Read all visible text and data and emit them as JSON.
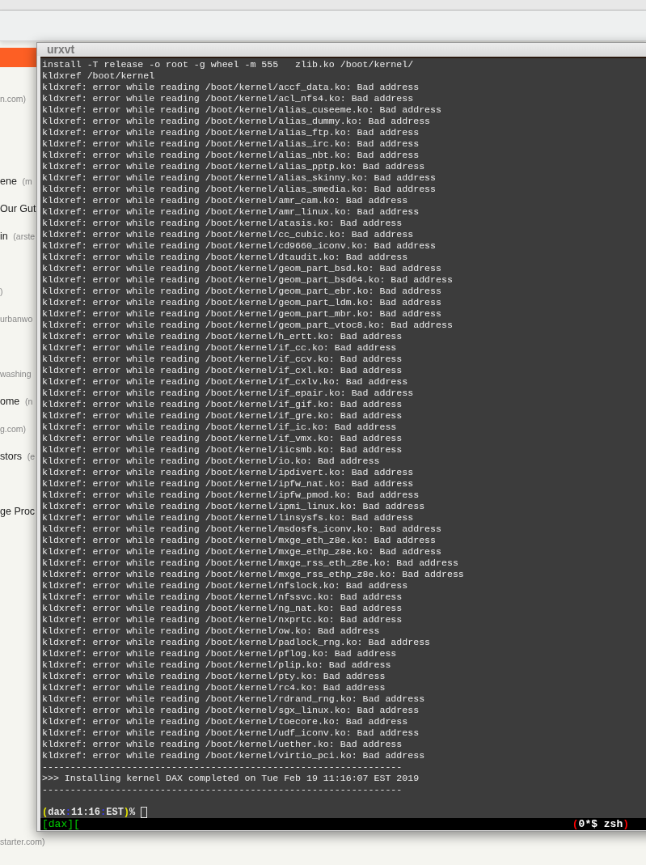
{
  "background_page": {
    "items": [
      {
        "source": "n.com)"
      },
      {
        "title": "ene",
        "source": "(m"
      },
      {
        "title": "Our Gut"
      },
      {
        "title": "in",
        "source": "(arste"
      },
      {
        "source": ")"
      },
      {
        "source": "urbanwo"
      },
      {
        "source": "washing"
      },
      {
        "title": "ome",
        "source": "(n"
      },
      {
        "source": "g.com)"
      },
      {
        "title": "stors",
        "source": "(e"
      },
      {
        "title": "ge Proc"
      },
      {
        "source": "starter.com)"
      }
    ]
  },
  "terminal": {
    "title": "urxvt",
    "lines": [
      "install -T release -o root -g wheel -m 555   zlib.ko /boot/kernel/",
      "kldxref /boot/kernel",
      "kldxref: error while reading /boot/kernel/accf_data.ko: Bad address",
      "kldxref: error while reading /boot/kernel/acl_nfs4.ko: Bad address",
      "kldxref: error while reading /boot/kernel/alias_cuseeme.ko: Bad address",
      "kldxref: error while reading /boot/kernel/alias_dummy.ko: Bad address",
      "kldxref: error while reading /boot/kernel/alias_ftp.ko: Bad address",
      "kldxref: error while reading /boot/kernel/alias_irc.ko: Bad address",
      "kldxref: error while reading /boot/kernel/alias_nbt.ko: Bad address",
      "kldxref: error while reading /boot/kernel/alias_pptp.ko: Bad address",
      "kldxref: error while reading /boot/kernel/alias_skinny.ko: Bad address",
      "kldxref: error while reading /boot/kernel/alias_smedia.ko: Bad address",
      "kldxref: error while reading /boot/kernel/amr_cam.ko: Bad address",
      "kldxref: error while reading /boot/kernel/amr_linux.ko: Bad address",
      "kldxref: error while reading /boot/kernel/atasis.ko: Bad address",
      "kldxref: error while reading /boot/kernel/cc_cubic.ko: Bad address",
      "kldxref: error while reading /boot/kernel/cd9660_iconv.ko: Bad address",
      "kldxref: error while reading /boot/kernel/dtaudit.ko: Bad address",
      "kldxref: error while reading /boot/kernel/geom_part_bsd.ko: Bad address",
      "kldxref: error while reading /boot/kernel/geom_part_bsd64.ko: Bad address",
      "kldxref: error while reading /boot/kernel/geom_part_ebr.ko: Bad address",
      "kldxref: error while reading /boot/kernel/geom_part_ldm.ko: Bad address",
      "kldxref: error while reading /boot/kernel/geom_part_mbr.ko: Bad address",
      "kldxref: error while reading /boot/kernel/geom_part_vtoc8.ko: Bad address",
      "kldxref: error while reading /boot/kernel/h_ertt.ko: Bad address",
      "kldxref: error while reading /boot/kernel/if_cc.ko: Bad address",
      "kldxref: error while reading /boot/kernel/if_ccv.ko: Bad address",
      "kldxref: error while reading /boot/kernel/if_cxl.ko: Bad address",
      "kldxref: error while reading /boot/kernel/if_cxlv.ko: Bad address",
      "kldxref: error while reading /boot/kernel/if_epair.ko: Bad address",
      "kldxref: error while reading /boot/kernel/if_gif.ko: Bad address",
      "kldxref: error while reading /boot/kernel/if_gre.ko: Bad address",
      "kldxref: error while reading /boot/kernel/if_ic.ko: Bad address",
      "kldxref: error while reading /boot/kernel/if_vmx.ko: Bad address",
      "kldxref: error while reading /boot/kernel/iicsmb.ko: Bad address",
      "kldxref: error while reading /boot/kernel/io.ko: Bad address",
      "kldxref: error while reading /boot/kernel/ipdivert.ko: Bad address",
      "kldxref: error while reading /boot/kernel/ipfw_nat.ko: Bad address",
      "kldxref: error while reading /boot/kernel/ipfw_pmod.ko: Bad address",
      "kldxref: error while reading /boot/kernel/ipmi_linux.ko: Bad address",
      "kldxref: error while reading /boot/kernel/linsysfs.ko: Bad address",
      "kldxref: error while reading /boot/kernel/msdosfs_iconv.ko: Bad address",
      "kldxref: error while reading /boot/kernel/mxge_eth_z8e.ko: Bad address",
      "kldxref: error while reading /boot/kernel/mxge_ethp_z8e.ko: Bad address",
      "kldxref: error while reading /boot/kernel/mxge_rss_eth_z8e.ko: Bad address",
      "kldxref: error while reading /boot/kernel/mxge_rss_ethp_z8e.ko: Bad address",
      "kldxref: error while reading /boot/kernel/nfslock.ko: Bad address",
      "kldxref: error while reading /boot/kernel/nfssvc.ko: Bad address",
      "kldxref: error while reading /boot/kernel/ng_nat.ko: Bad address",
      "kldxref: error while reading /boot/kernel/nxprtc.ko: Bad address",
      "kldxref: error while reading /boot/kernel/ow.ko: Bad address",
      "kldxref: error while reading /boot/kernel/padlock_rng.ko: Bad address",
      "kldxref: error while reading /boot/kernel/pflog.ko: Bad address",
      "kldxref: error while reading /boot/kernel/plip.ko: Bad address",
      "kldxref: error while reading /boot/kernel/pty.ko: Bad address",
      "kldxref: error while reading /boot/kernel/rc4.ko: Bad address",
      "kldxref: error while reading /boot/kernel/rdrand_rng.ko: Bad address",
      "kldxref: error while reading /boot/kernel/sgx_linux.ko: Bad address",
      "kldxref: error while reading /boot/kernel/toecore.ko: Bad address",
      "kldxref: error while reading /boot/kernel/udf_iconv.ko: Bad address",
      "kldxref: error while reading /boot/kernel/uether.ko: Bad address",
      "kldxref: error while reading /boot/kernel/virtio_pci.ko: Bad address",
      "----------------------------------------------------------------",
      ">>> Installing kernel DAX completed on Tue Feb 19 11:16:07 EST 2019",
      "----------------------------------------------------------------"
    ],
    "prompt": [
      {
        "text": "(",
        "color": "#e5e500"
      },
      {
        "text": "dax",
        "color": "#e5e5e5"
      },
      {
        "text": ":",
        "color": "#3b3bff"
      },
      {
        "text": "11:16",
        "color": "#e5e5e5"
      },
      {
        "text": ":",
        "color": "#3b3bff"
      },
      {
        "text": "EST",
        "color": "#e5e5e5"
      },
      {
        "text": ")",
        "color": "#e5e500"
      },
      {
        "text": "%",
        "color": "#e5e5e5"
      }
    ],
    "status_bar": {
      "session": "[dax][",
      "window": {
        "open": "(",
        "label": "0*$ zsh",
        "close": ")"
      }
    }
  }
}
